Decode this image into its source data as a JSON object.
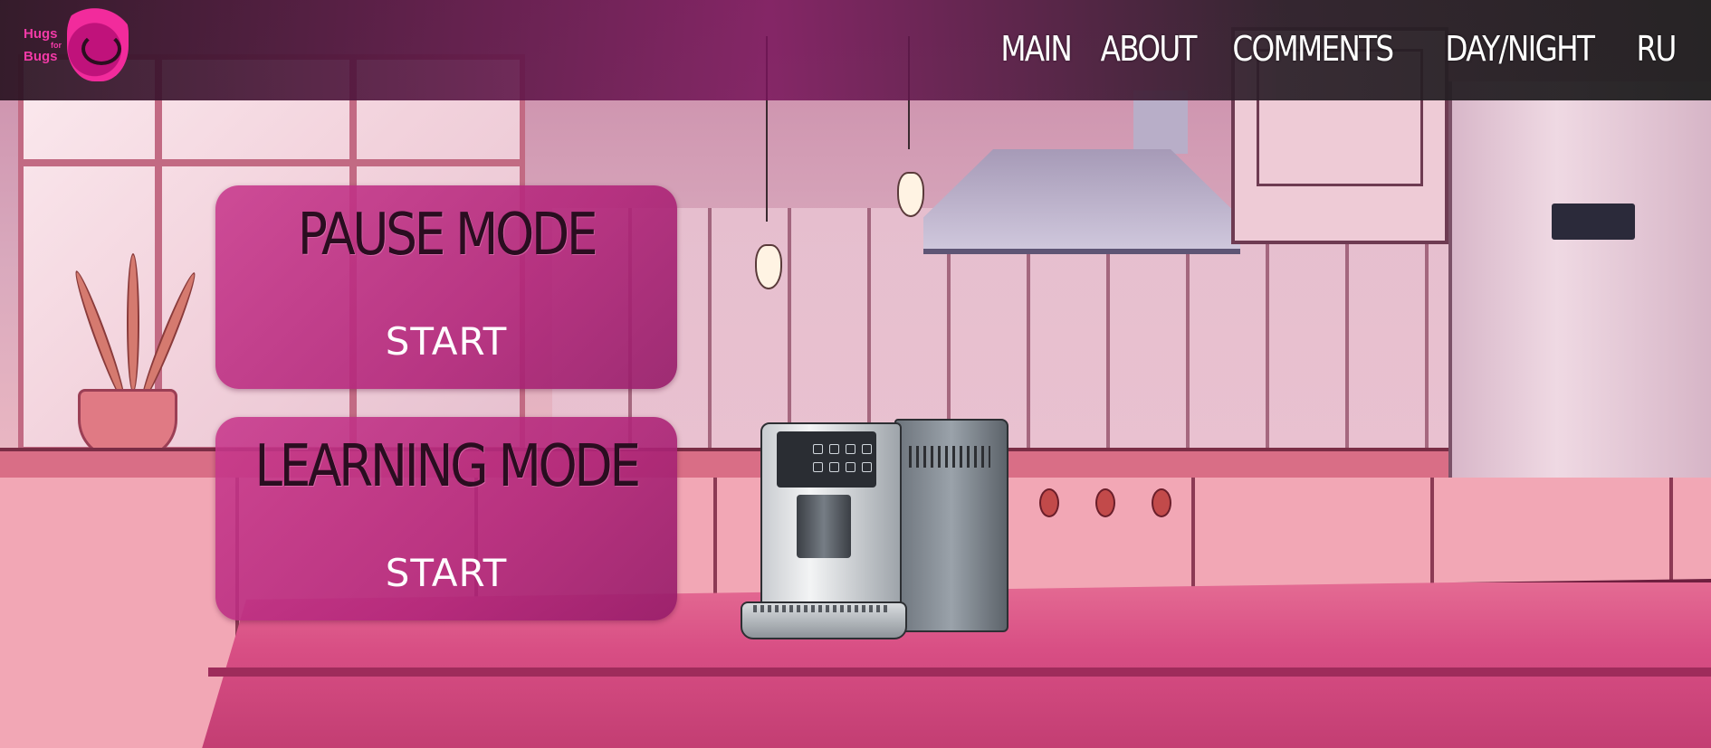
{
  "brand": {
    "logo_text_top": "Hugs",
    "logo_text_mid": "for",
    "logo_text_bottom": "Bugs",
    "accent_color": "#f23aa7"
  },
  "nav": {
    "items": [
      {
        "label": "MAIN"
      },
      {
        "label": "ABOUT"
      },
      {
        "label": "COMMENTS"
      },
      {
        "label": "DAY/NIGHT"
      },
      {
        "label": "RU"
      }
    ]
  },
  "modes": [
    {
      "title": "PAUSE MODE",
      "action_label": "START"
    },
    {
      "title": "LEARNING MODE",
      "action_label": "START"
    }
  ],
  "scene": {
    "background": "kitchen-illustration",
    "centerpiece": "coffee-machine-illustration",
    "card_color": "#c0267e"
  }
}
